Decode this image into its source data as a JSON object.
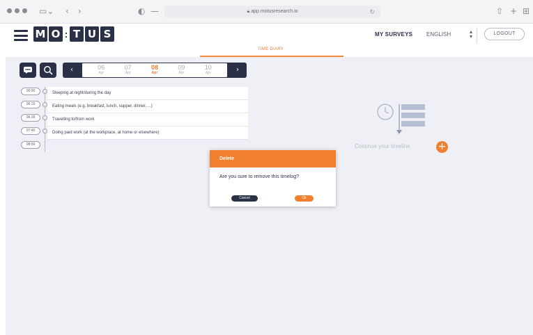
{
  "browser": {
    "url": "app.motusresearch.io",
    "lock_icon": "lock-icon",
    "reload_icon": "reload-icon"
  },
  "header": {
    "logo_letters": [
      "M",
      "O",
      "T",
      "U",
      "S"
    ],
    "logo_separator": ":",
    "my_surveys": "MY SURVEYS",
    "language": "ENGLISH",
    "logout": "LOGOUT",
    "active_tab": "TIME DIARY"
  },
  "date_nav": {
    "dates": [
      {
        "day": "06",
        "month": "Apr"
      },
      {
        "day": "07",
        "month": "Apr"
      },
      {
        "day": "08",
        "month": "Apr"
      },
      {
        "day": "09",
        "month": "Apr"
      },
      {
        "day": "10",
        "month": "Apr"
      }
    ],
    "selected_index": 2
  },
  "timeline": {
    "times": [
      "00:00",
      "06:15",
      "06:28",
      "07:46",
      "08:09"
    ],
    "activities": [
      "Sleeping at night/during the day",
      "Eating meals (e.g. breakfast, lunch, supper, dinner, ...)",
      "Travelling to/from work",
      "Doing paid work (at the workplace, at home or elsewhere)"
    ]
  },
  "empty_state": {
    "text": "Continue your timeline.",
    "add_label": "+"
  },
  "modal": {
    "title": "Delete",
    "message": "Are you sure to remove this timelog?",
    "cancel": "Cancel",
    "ok": "Ok"
  },
  "colors": {
    "navy": "#2a3147",
    "accent": "#f07f2e",
    "background": "#eef0f5"
  }
}
